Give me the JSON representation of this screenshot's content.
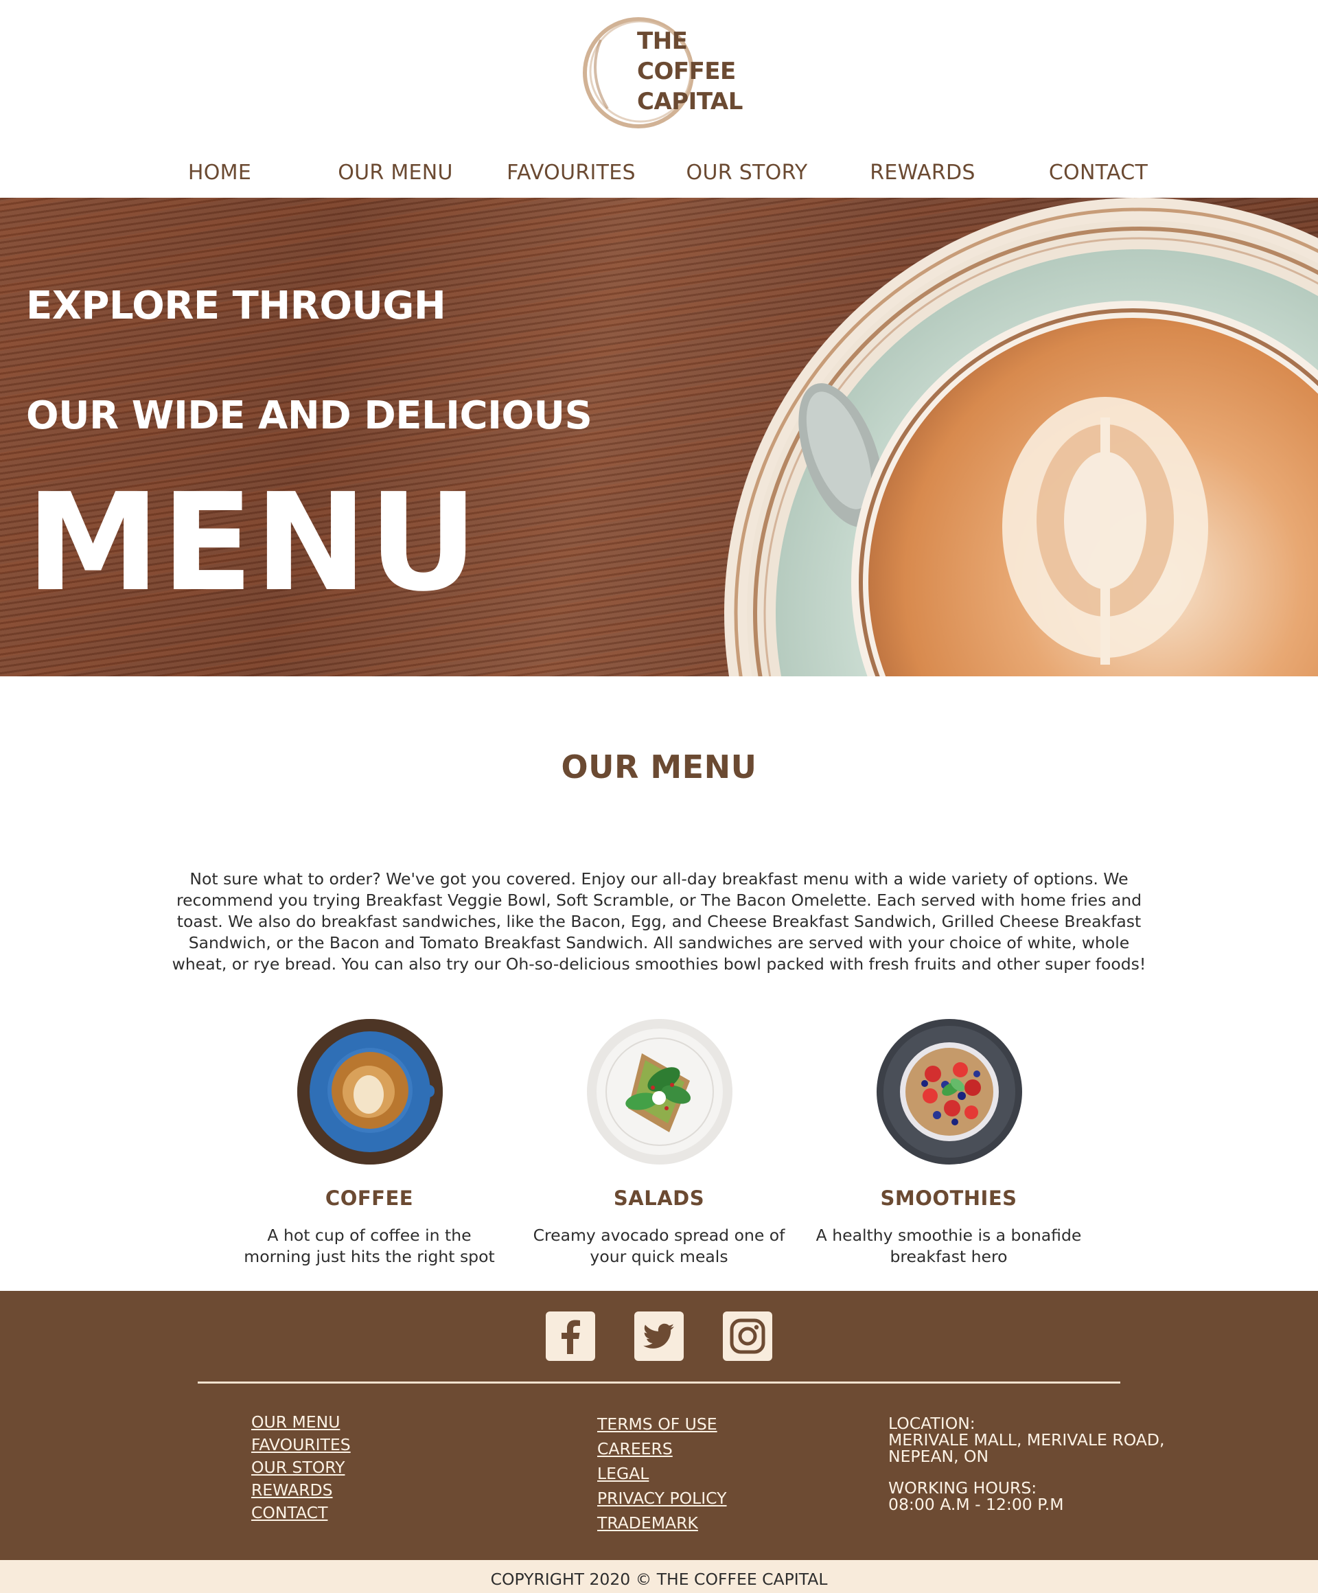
{
  "brand": {
    "logo_lines": [
      "THE",
      "COFFEE",
      "CAPITAL"
    ],
    "color": "#6b4a32",
    "footer_color": "#6d4b33",
    "cream": "#f8ecdd"
  },
  "nav": {
    "items": [
      {
        "label": "HOME"
      },
      {
        "label": "OUR MENU"
      },
      {
        "label": "FAVOURITES"
      },
      {
        "label": "OUR STORY"
      },
      {
        "label": "REWARDS"
      },
      {
        "label": "CONTACT"
      }
    ]
  },
  "hero": {
    "line1": "EXPLORE THROUGH",
    "line2": "OUR WIDE AND DELICIOUS",
    "line3": "MENU"
  },
  "menu": {
    "title": "OUR MENU",
    "intro": "Not sure what to order? We've got you covered. Enjoy our all-day breakfast menu with a wide variety of options. We recommend you trying Breakfast Veggie Bowl, Soft Scramble, or The Bacon Omelette. Each served with home fries and toast. We also do breakfast sandwiches, like the Bacon, Egg, and Cheese Breakfast Sandwich, Grilled Cheese Breakfast Sandwich, or the Bacon and Tomato Breakfast Sandwich. All sandwiches are served with your choice of white, whole wheat, or rye bread. You can also try our Oh-so-delicious smoothies bowl packed with fresh fruits and other super foods!",
    "cards": [
      {
        "title": "COFFEE",
        "desc": "A hot cup of coffee in the morning just hits the right spot",
        "image": "coffee-cup-image"
      },
      {
        "title": "SALADS",
        "desc": "Creamy avocado spread one of your quick meals",
        "image": "avocado-toast-image"
      },
      {
        "title": "SMOOTHIES",
        "desc": "A healthy smoothie is a bonafide breakfast hero",
        "image": "smoothie-bowl-image"
      }
    ]
  },
  "footer": {
    "social": [
      {
        "icon": "facebook-icon"
      },
      {
        "icon": "twitter-icon"
      },
      {
        "icon": "instagram-icon"
      }
    ],
    "col1": [
      "OUR MENU",
      "FAVOURITES",
      "OUR STORY",
      "REWARDS",
      "CONTACT"
    ],
    "col2": [
      "TERMS OF USE",
      "CAREERS",
      "LEGAL",
      "PRIVACY POLICY",
      "TRADEMARK"
    ],
    "location_label": "LOCATION:",
    "location_line1": "MERIVALE MALL, MERIVALE ROAD,",
    "location_line2": "NEPEAN, ON",
    "hours_label": "WORKING HOURS:",
    "hours_value": "08:00 A.M - 12:00 P.M",
    "copyright": "COPYRIGHT 2020 © THE COFFEE CAPITAL"
  }
}
